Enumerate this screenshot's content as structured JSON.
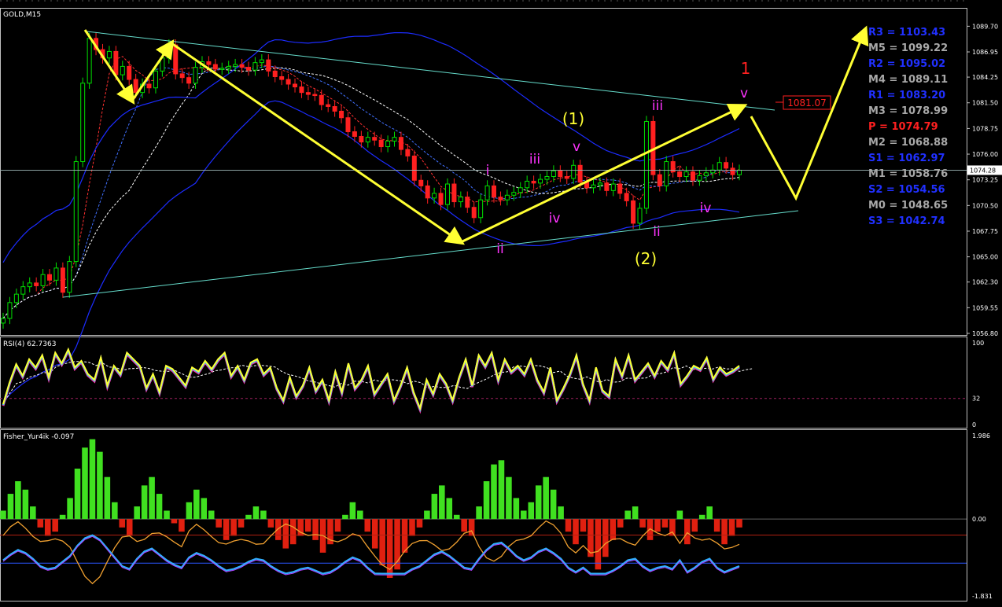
{
  "window": {
    "title": "GOLD,M15",
    "current_price": "1074.28"
  },
  "colors": {
    "background": "#000000",
    "frame": "#c0c0c0",
    "bull_candle": "#00e000",
    "bear_candle": "#ff2020",
    "arrow": "#ffff33",
    "wave_label": "#ff33ff",
    "wave_major": "#ffff33",
    "channel": "#66ddcc",
    "bands": "#1c2cff",
    "pivot_blue": "#2030ff",
    "pivot_gray": "#a8a8a8",
    "pivot_red": "#ff2020"
  },
  "chart_data": [
    {
      "type": "line",
      "name": "price",
      "symbol": "GOLD",
      "timeframe": "M15",
      "ylim": [
        1056.8,
        1091.5
      ],
      "yticks": [
        "1089.70",
        "1086.95",
        "1084.25",
        "1081.50",
        "1078.75",
        "1076.00",
        "1073.25",
        "1070.50",
        "1067.75",
        "1065.00",
        "1062.30",
        "1059.55",
        "1056.80"
      ],
      "close": [
        1058.4,
        1060.1,
        1061.0,
        1061.8,
        1062.2,
        1061.9,
        1063.1,
        1062.5,
        1063.8,
        1061.2,
        1064.5,
        1075.2,
        1083.6,
        1088.4,
        1087.2,
        1086.3,
        1087.0,
        1084.5,
        1085.4,
        1084.0,
        1082.6,
        1083.5,
        1083.1,
        1084.9,
        1086.3,
        1087.7,
        1084.6,
        1084.2,
        1083.6,
        1085.3,
        1085.9,
        1085.6,
        1085.1,
        1085.2,
        1085.4,
        1085.6,
        1085.3,
        1085.0,
        1085.8,
        1086.1,
        1084.9,
        1084.3,
        1084.0,
        1083.5,
        1083.2,
        1082.6,
        1082.4,
        1082.3,
        1081.3,
        1081.1,
        1080.6,
        1079.9,
        1078.4,
        1077.9,
        1077.3,
        1077.8,
        1077.5,
        1076.8,
        1077.4,
        1077.8,
        1076.5,
        1075.8,
        1073.2,
        1072.6,
        1071.3,
        1071.8,
        1070.6,
        1072.8,
        1070.9,
        1071.4,
        1070.3,
        1069.2,
        1071.1,
        1072.6,
        1071.4,
        1071.1,
        1071.6,
        1071.9,
        1072.4,
        1073.1,
        1072.9,
        1073.3,
        1073.6,
        1074.2,
        1073.6,
        1073.4,
        1074.8,
        1073.0,
        1072.4,
        1072.7,
        1072.9,
        1072.1,
        1072.8,
        1071.8,
        1071.0,
        1068.6,
        1070.2,
        1079.5,
        1073.8,
        1072.6,
        1075.2,
        1074.1,
        1073.6,
        1074.1,
        1073.2,
        1073.7,
        1074.0,
        1074.3,
        1075.1,
        1074.5,
        1073.8,
        1074.28
      ],
      "waves": {
        "major_1": "(1)",
        "major_2": "(2)",
        "major_big_1": "1",
        "minor": [
          "i",
          "ii",
          "iii",
          "iv",
          "v"
        ]
      },
      "pivots": [
        {
          "label": "R3",
          "value": "1103.43",
          "color": "#2030ff"
        },
        {
          "label": "M5",
          "value": "1099.22",
          "color": "#a8a8a8"
        },
        {
          "label": "R2",
          "value": "1095.02",
          "color": "#2030ff"
        },
        {
          "label": "M4",
          "value": "1089.11",
          "color": "#a8a8a8"
        },
        {
          "label": "R1",
          "value": "1083.20",
          "color": "#2030ff"
        },
        {
          "label": "M3",
          "value": "1078.99",
          "color": "#a8a8a8"
        },
        {
          "label": "P ",
          "value": "1074.79",
          "color": "#ff2020"
        },
        {
          "label": "M2",
          "value": "1068.88",
          "color": "#a8a8a8"
        },
        {
          "label": "S1",
          "value": "1062.97",
          "color": "#2030ff"
        },
        {
          "label": "M1",
          "value": "1058.76",
          "color": "#a8a8a8"
        },
        {
          "label": "S2",
          "value": "1054.56",
          "color": "#2030ff"
        },
        {
          "label": "M0",
          "value": "1048.65",
          "color": "#a8a8a8"
        },
        {
          "label": "S3",
          "value": "1042.74",
          "color": "#2030ff"
        }
      ],
      "price_tag": "1081.07"
    },
    {
      "type": "line",
      "name": "RSI(4) 62.7363",
      "ylim": [
        0,
        100
      ],
      "yticks": [
        "100",
        "32",
        "0"
      ],
      "level": 32,
      "values": [
        25,
        52,
        74,
        60,
        80,
        70,
        85,
        58,
        88,
        75,
        92,
        70,
        78,
        62,
        55,
        82,
        48,
        72,
        62,
        88,
        80,
        72,
        45,
        62,
        40,
        72,
        68,
        58,
        48,
        70,
        65,
        78,
        68,
        80,
        88,
        60,
        72,
        55,
        76,
        80,
        62,
        70,
        45,
        30,
        58,
        35,
        48,
        70,
        42,
        55,
        30,
        65,
        40,
        75,
        45,
        55,
        72,
        38,
        50,
        62,
        30,
        48,
        70,
        40,
        20,
        55,
        38,
        62,
        50,
        30,
        58,
        80,
        48,
        85,
        72,
        88,
        55,
        80,
        65,
        72,
        62,
        80,
        55,
        40,
        70,
        30,
        45,
        62,
        85,
        50,
        30,
        70,
        42,
        35,
        80,
        60,
        85,
        55,
        65,
        75,
        60,
        78,
        68,
        88,
        50,
        60,
        72,
        68,
        82,
        56,
        70,
        62,
        66,
        72
      ]
    },
    {
      "type": "bar",
      "name": "Fisher_Yur4ik -0.097",
      "ylim": [
        -1.831,
        1.986
      ],
      "yticks": [
        "1.986",
        "0.00",
        "-1.831"
      ],
      "values": [
        0.2,
        0.6,
        0.9,
        0.7,
        0.3,
        -0.2,
        -0.4,
        -0.3,
        0.1,
        0.5,
        1.2,
        1.7,
        1.9,
        1.6,
        1.0,
        0.4,
        -0.2,
        -0.4,
        0.3,
        0.8,
        1.0,
        0.6,
        0.2,
        -0.1,
        -0.3,
        0.4,
        0.7,
        0.5,
        0.2,
        -0.2,
        -0.5,
        -0.4,
        -0.2,
        0.1,
        0.3,
        0.2,
        -0.2,
        -0.5,
        -0.7,
        -0.6,
        -0.4,
        -0.3,
        -0.5,
        -0.8,
        -0.6,
        -0.3,
        0.1,
        0.4,
        0.2,
        -0.3,
        -0.7,
        -1.1,
        -1.4,
        -1.2,
        -0.8,
        -0.4,
        -0.2,
        0.2,
        0.6,
        0.8,
        0.5,
        0.1,
        -0.3,
        -0.4,
        0.3,
        0.9,
        1.3,
        1.4,
        1.0,
        0.5,
        0.2,
        0.4,
        0.8,
        1.0,
        0.7,
        0.3,
        -0.3,
        -0.6,
        -0.3,
        -0.9,
        -1.2,
        -0.9,
        -0.5,
        -0.2,
        0.2,
        0.3,
        -0.2,
        -0.5,
        -0.3,
        -0.2,
        -0.4,
        0.2,
        -0.6,
        -0.3,
        0.1,
        0.3,
        -0.3,
        -0.6,
        -0.4,
        -0.2
      ]
    }
  ]
}
